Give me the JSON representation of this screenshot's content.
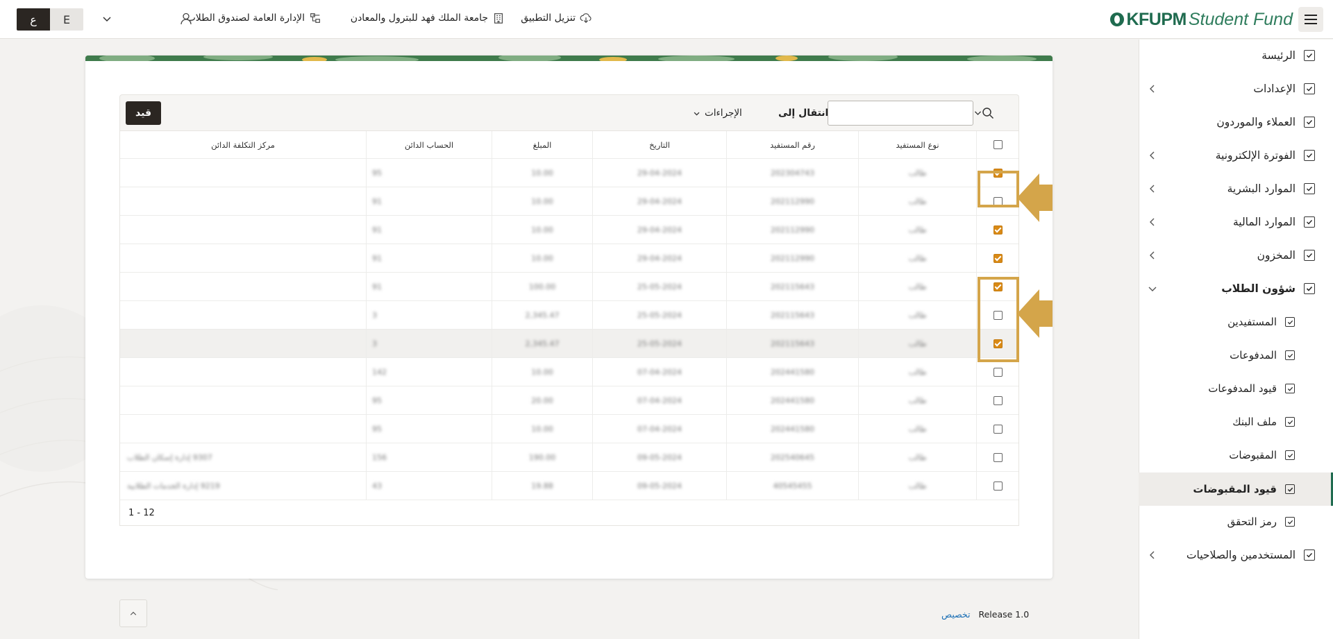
{
  "header": {
    "brand_main": "KFUPM",
    "brand_sub": "Student Fund",
    "download_app": "تنزيل التطبيق",
    "university": "جامعة الملك فهد للبترول والمعادن",
    "department": "الإدارة العامة لصندوق الطلاب",
    "lang_ar": "ع",
    "lang_en": "E"
  },
  "sidebar": {
    "items": [
      {
        "label": "الرئيسة"
      },
      {
        "label": "الإعدادات"
      },
      {
        "label": "العملاء والموردون"
      },
      {
        "label": "الفوترة الإلكترونية"
      },
      {
        "label": "الموارد البشرية"
      },
      {
        "label": "الموارد المالية"
      },
      {
        "label": "المخزون"
      },
      {
        "label": "شؤون الطلاب"
      },
      {
        "label": "المستفيدين"
      },
      {
        "label": "المدفوعات"
      },
      {
        "label": "قيود المدفوعات"
      },
      {
        "label": "ملف البنك"
      },
      {
        "label": "المقبوضات"
      },
      {
        "label": "قيود المقبوضات"
      },
      {
        "label": "رمز التحقق"
      },
      {
        "label": "المستخدمين والصلاحيات"
      }
    ]
  },
  "toolbar": {
    "qayd_button": "قيد",
    "actions_label": "الإجراءات",
    "goto_label": "انتقال إلى",
    "search_value": ""
  },
  "table": {
    "columns": [
      "نوع المستفيد",
      "رقم المستفيد",
      "التاريخ",
      "المبلغ",
      "الحساب الدائن",
      "مركز التكلفة الدائن"
    ],
    "rows": [
      {
        "checked": true,
        "cells": [
          "طالب",
          "202304743",
          "29-04-2024",
          "10.00",
          "95",
          ""
        ]
      },
      {
        "checked": false,
        "cells": [
          "طالب",
          "202112990",
          "29-04-2024",
          "10.00",
          "91",
          ""
        ]
      },
      {
        "checked": true,
        "cells": [
          "طالب",
          "202112990",
          "29-04-2024",
          "10.00",
          "91",
          ""
        ]
      },
      {
        "checked": true,
        "cells": [
          "طالب",
          "202112990",
          "29-04-2024",
          "10.00",
          "91",
          ""
        ]
      },
      {
        "checked": true,
        "cells": [
          "طالب",
          "202115643",
          "25-05-2024",
          "100.00",
          "91",
          ""
        ]
      },
      {
        "checked": false,
        "cells": [
          "طالب",
          "202115643",
          "25-05-2024",
          "2,345.47",
          "3",
          ""
        ]
      },
      {
        "checked": true,
        "cells": [
          "طالب",
          "202115643",
          "25-05-2024",
          "2,345.47",
          "3",
          ""
        ]
      },
      {
        "checked": false,
        "cells": [
          "طالب",
          "202441580",
          "07-04-2024",
          "10.00",
          "142",
          ""
        ]
      },
      {
        "checked": false,
        "cells": [
          "طالب",
          "202441580",
          "07-04-2024",
          "20.00",
          "95",
          ""
        ]
      },
      {
        "checked": false,
        "cells": [
          "طالب",
          "202441580",
          "07-04-2024",
          "10.00",
          "95",
          ""
        ]
      },
      {
        "checked": false,
        "cells": [
          "طالب",
          "202540645",
          "09-05-2024",
          "190.00",
          "156",
          "9307 إدارة إسكان الطلاب"
        ]
      },
      {
        "checked": false,
        "cells": [
          "طالب",
          "40545455",
          "09-05-2024",
          "19.88",
          "43",
          "9219 إدارة الخدمات الطلابية"
        ]
      }
    ],
    "pagination": "1 - 12"
  },
  "footer": {
    "release": "Release 1.0",
    "customize": "تخصيص"
  }
}
